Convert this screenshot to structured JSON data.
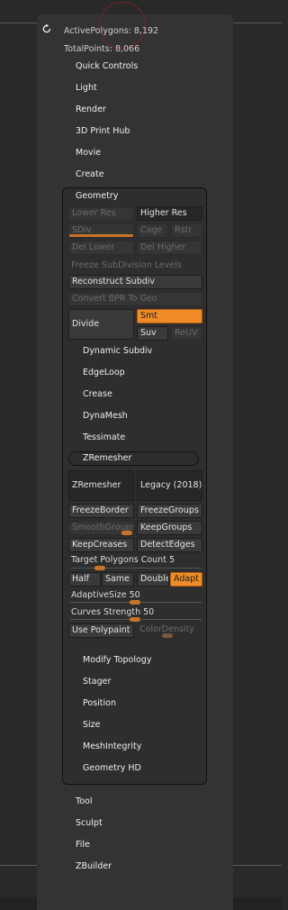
{
  "stats": {
    "active_polygons": "ActivePolygons: 8,192",
    "total_points": "TotalPoints: 8,066"
  },
  "menus_top": [
    "Quick Controls",
    "Light",
    "Render",
    "3D Print Hub",
    "Movie",
    "Create"
  ],
  "geometry": {
    "title": "Geometry",
    "lower_res": "Lower Res",
    "higher_res": "Higher Res",
    "sdiv": "SDiv",
    "cage": "Cage",
    "rstr": "Rstr",
    "del_lower": "Del Lower",
    "del_higher": "Del Higher",
    "freeze_subdiv": "Freeze SubDivision Levels",
    "reconstruct": "Reconstruct Subdiv",
    "convert_bpr": "Convert BPR To Geo",
    "divide": "Divide",
    "smt": "Smt",
    "suv": "Suv",
    "reuv": "ReUV",
    "subpanels_a": [
      "Dynamic Subdiv",
      "EdgeLoop",
      "Crease",
      "DynaMesh",
      "Tessimate"
    ],
    "zremesher": {
      "title": "ZRemesher",
      "zremesher_btn": "ZRemesher",
      "legacy": "Legacy (2018)",
      "freeze_border": "FreezeBorder",
      "freeze_groups": "FreezeGroups",
      "smooth_groups": "SmoothGroups",
      "keep_groups": "KeepGroups",
      "keep_creases": "KeepCreases",
      "detect_edges": "DetectEdges",
      "target_label": "Target Polygons Count",
      "target_value": "5",
      "half": "Half",
      "same": "Same",
      "double": "Double",
      "adapt": "Adapt",
      "adaptive_label": "AdaptiveSize",
      "adaptive_value": "50",
      "curves_label": "Curves Strength",
      "curves_value": "50",
      "use_polypaint": "Use Polypaint",
      "color_density": "ColorDensity"
    },
    "subpanels_b": [
      "Modify Topology",
      "Stager",
      "Position",
      "Size",
      "MeshIntegrity",
      "Geometry HD"
    ]
  },
  "menus_bottom": [
    "Tool",
    "Sculpt",
    "File",
    "ZBuilder"
  ],
  "colors": {
    "accent": "#f08c28",
    "slider": "#c87428"
  }
}
